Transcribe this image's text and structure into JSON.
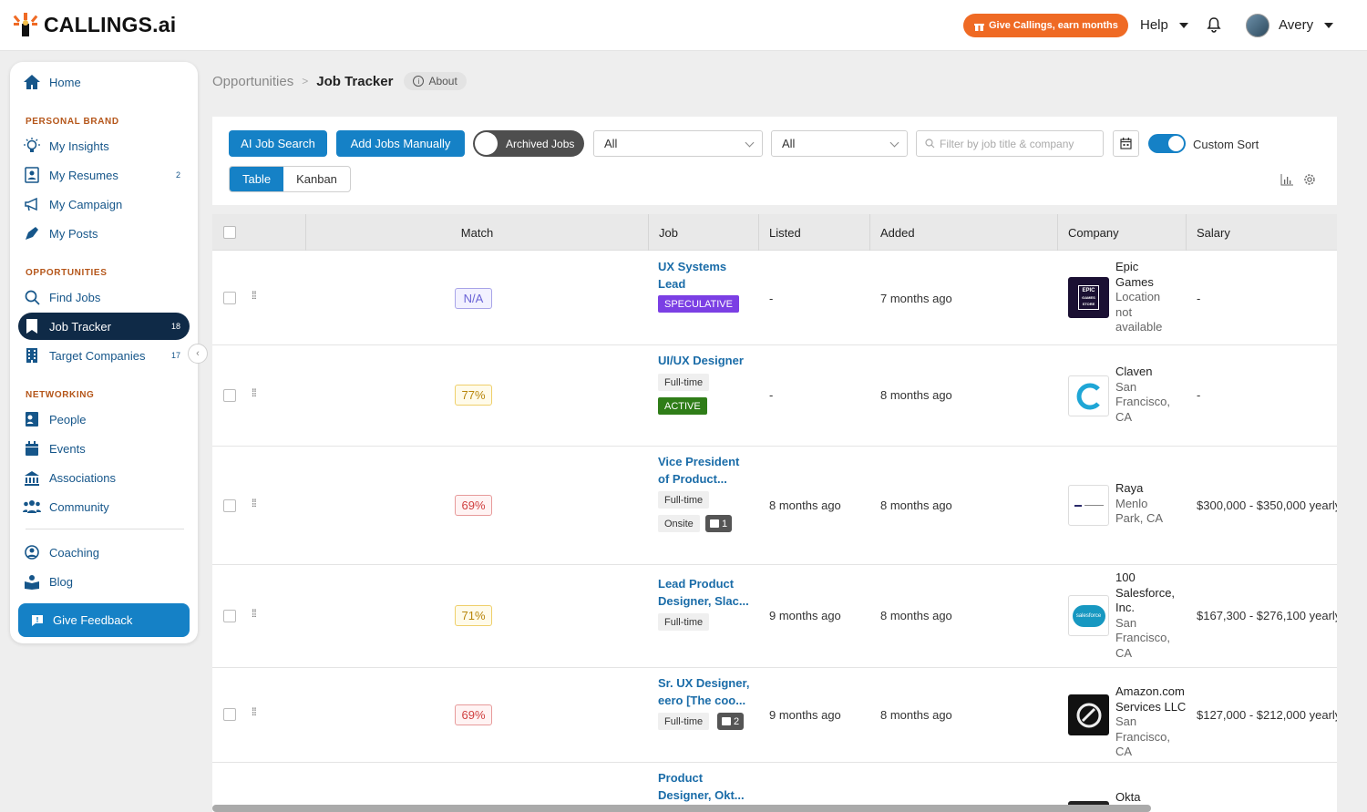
{
  "app": {
    "name": "CALLINGS.ai"
  },
  "header": {
    "promo_label": "Give Callings, earn months",
    "help_label": "Help",
    "user_name": "Avery"
  },
  "sidebar": {
    "home": "Home",
    "sections": {
      "brand": "PERSONAL BRAND",
      "opps": "OPPORTUNITIES",
      "net": "NETWORKING"
    },
    "items": [
      {
        "label": "My Insights",
        "icon": "lightbulb-icon"
      },
      {
        "label": "My Resumes",
        "icon": "resume-icon",
        "count": "2"
      },
      {
        "label": "My Campaign",
        "icon": "megaphone-icon"
      },
      {
        "label": "My Posts",
        "icon": "pen-icon"
      },
      {
        "label": "Find Jobs",
        "icon": "search-icon"
      },
      {
        "label": "Job Tracker",
        "icon": "bookmark-icon",
        "count": "18"
      },
      {
        "label": "Target Companies",
        "icon": "building-icon",
        "count": "17"
      },
      {
        "label": "People",
        "icon": "person-card-icon"
      },
      {
        "label": "Events",
        "icon": "calendar-icon"
      },
      {
        "label": "Associations",
        "icon": "institution-icon"
      },
      {
        "label": "Community",
        "icon": "group-icon"
      },
      {
        "label": "Coaching",
        "icon": "coach-icon"
      },
      {
        "label": "Blog",
        "icon": "reader-icon"
      }
    ],
    "feedback": "Give Feedback"
  },
  "breadcrumb": {
    "parent": "Opportunities",
    "current": "Job Tracker",
    "about": "About"
  },
  "toolbar": {
    "ai_search": "AI Job Search",
    "add_manual": "Add Jobs Manually",
    "archived": "Archived Jobs",
    "select1": "All",
    "select2": "All",
    "search_placeholder": "Filter by job title & company",
    "custom_sort": "Custom Sort",
    "view_table": "Table",
    "view_kanban": "Kanban"
  },
  "table": {
    "headers": [
      "Match",
      "Job",
      "Listed",
      "Added",
      "Company",
      "Salary"
    ],
    "rows": [
      {
        "match": "N/A",
        "title_lines": [
          "UX Systems",
          "Lead"
        ],
        "tags": [
          "SPECULATIVE"
        ],
        "listed": "-",
        "added": "7 months ago",
        "company": [
          "Epic",
          "Games"
        ],
        "location": [
          "Location",
          "not",
          "available"
        ],
        "salary": "-"
      },
      {
        "match": "77%",
        "title_lines": [
          "UI/UX Designer"
        ],
        "tags": [
          "Full-time",
          "ACTIVE"
        ],
        "listed": "-",
        "added": "8 months ago",
        "company": [
          "Claven"
        ],
        "location": [
          "San",
          "Francisco,",
          "CA"
        ],
        "salary": "-"
      },
      {
        "match": "69%",
        "title_lines": [
          "Vice President",
          "of Product..."
        ],
        "tags": [
          "Full-time",
          "Onsite"
        ],
        "notes": "1",
        "listed": "8 months ago",
        "added": "8 months ago",
        "company": [
          "Raya"
        ],
        "location": [
          "Menlo",
          "Park, CA"
        ],
        "salary": "$300,000 - $350,000 yearly"
      },
      {
        "match": "71%",
        "title_lines": [
          "Lead Product",
          "Designer, Slac..."
        ],
        "tags": [
          "Full-time"
        ],
        "listed": "9 months ago",
        "added": "8 months ago",
        "company": [
          "100",
          "Salesforce,",
          "Inc."
        ],
        "location": [
          "San",
          "Francisco,",
          "CA"
        ],
        "salary": "$167,300 - $276,100 yearly"
      },
      {
        "match": "69%",
        "title_lines": [
          "Sr. UX Designer,",
          "eero [The coo..."
        ],
        "tags": [
          "Full-time"
        ],
        "notes": "2",
        "listed": "9 months ago",
        "added": "8 months ago",
        "company": [
          "Amazon.com",
          "Services LLC"
        ],
        "location": [
          "San",
          "Francisco, CA"
        ],
        "salary": "$127,000 - $212,000 yearly"
      },
      {
        "title_lines": [
          "Product",
          "Designer, Okt..."
        ],
        "company": [
          "Okta"
        ]
      }
    ]
  },
  "logos": {
    "epic_line1": "EPIC",
    "epic_line2": "GAMES",
    "epic_line3": "STORE",
    "salesforce": "salesforce"
  },
  "colors": {
    "accent": "#1581c6",
    "navy": "#0f2a47",
    "promo": "#ef6a24",
    "section": "#b5561a"
  }
}
